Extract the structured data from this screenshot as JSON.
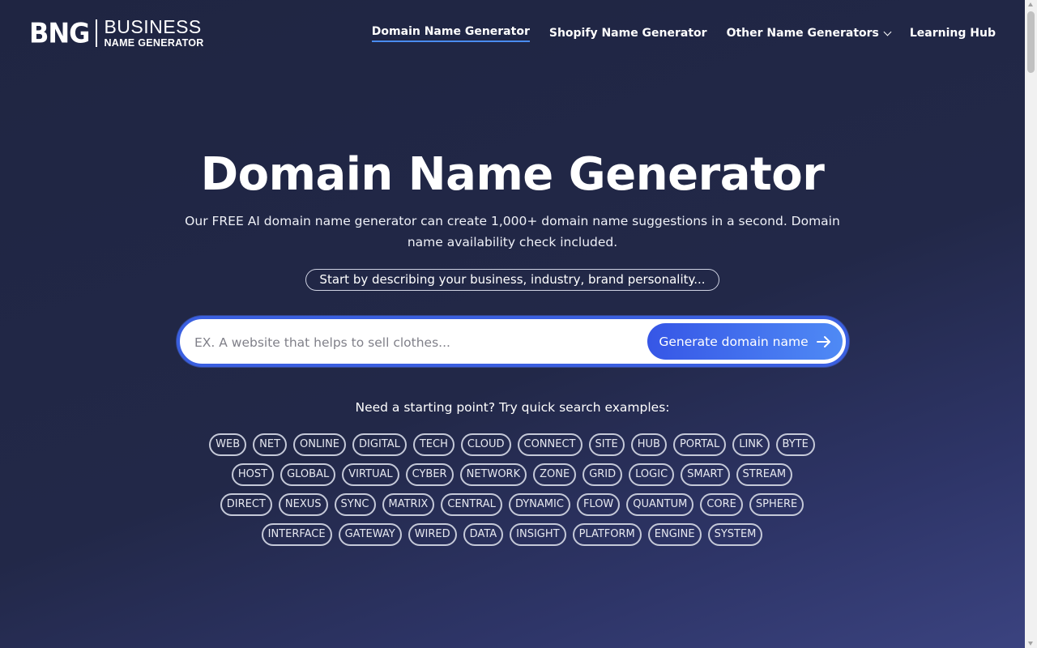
{
  "header": {
    "logo": {
      "mark": "BNG",
      "line1": "BUSINESS",
      "line2": "NAME GENERATOR"
    },
    "nav": [
      {
        "label": "Domain Name Generator",
        "active": true
      },
      {
        "label": "Shopify Name Generator",
        "active": false
      },
      {
        "label": "Other Name Generators",
        "active": false,
        "dropdown": true
      },
      {
        "label": "Learning Hub",
        "active": false
      }
    ]
  },
  "hero": {
    "title": "Domain Name Generator",
    "subtitle": "Our FREE AI domain name generator can create 1,000+ domain name suggestions in a second. Domain name availability check included.",
    "hint": "Start by describing your business, industry, brand personality..."
  },
  "search": {
    "placeholder": "EX. A website that helps to sell clothes...",
    "value": "",
    "button_label": "Generate domain name",
    "button_icon": "arrow-right-icon"
  },
  "examples": {
    "label": "Need a starting point? Try quick search examples:",
    "rows": [
      [
        "WEB",
        "NET",
        "ONLINE",
        "DIGITAL",
        "TECH",
        "CLOUD",
        "CONNECT",
        "SITE",
        "HUB",
        "PORTAL",
        "LINK",
        "BYTE"
      ],
      [
        "HOST",
        "GLOBAL",
        "VIRTUAL",
        "CYBER",
        "NETWORK",
        "ZONE",
        "GRID",
        "LOGIC",
        "SMART",
        "STREAM"
      ],
      [
        "DIRECT",
        "NEXUS",
        "SYNC",
        "MATRIX",
        "CENTRAL",
        "DYNAMIC",
        "FLOW",
        "QUANTUM",
        "CORE",
        "SPHERE"
      ],
      [
        "INTERFACE",
        "GATEWAY",
        "WIRED",
        "DATA",
        "INSIGHT",
        "PLATFORM",
        "ENGINE",
        "SYSTEM"
      ]
    ]
  },
  "colors": {
    "background": "#222848",
    "accent": "#3a5fe0",
    "button_gradient_start": "#3656e6",
    "button_gradient_end": "#4f8af5",
    "active_underline": "#4a8cf0"
  }
}
